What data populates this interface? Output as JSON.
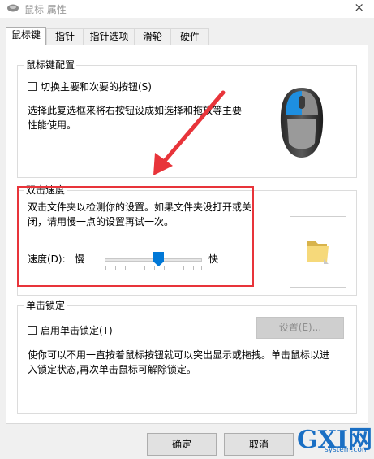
{
  "window": {
    "title": "鼠标 属性",
    "close_glyph": "×"
  },
  "tabs": [
    {
      "label": "鼠标键",
      "active": true
    },
    {
      "label": "指针",
      "active": false
    },
    {
      "label": "指针选项",
      "active": false
    },
    {
      "label": "滑轮",
      "active": false
    },
    {
      "label": "硬件",
      "active": false
    }
  ],
  "button_config": {
    "title": "鼠标键配置",
    "swap_label": "切换主要和次要的按钮(S)",
    "swap_checked": false,
    "desc_line1": "选择此复选框来将右按钮设成如选择和拖放等主要",
    "desc_line2": "性能使用。"
  },
  "double_click": {
    "title": "双击速度",
    "desc_line1": "双击文件夹以检测你的设置。如果文件夹没打开或关",
    "desc_line2": "闭，请用慢一点的设置再试一次。",
    "speed_label": "速度(D):",
    "slow_label": "慢",
    "fast_label": "快",
    "speed_fraction": 0.55
  },
  "click_lock": {
    "title": "单击锁定",
    "enable_label": "启用单击锁定(T)",
    "enable_checked": false,
    "settings_label": "设置(E)...",
    "desc_line1": "使你可以不用一直按着鼠标按钮就可以突出显示或拖拽。单击鼠标以进",
    "desc_line2": "入锁定状态,再次单击鼠标可解除锁定。"
  },
  "footer": {
    "ok_label": "确定",
    "cancel_label": "取消"
  },
  "watermark": {
    "logo_text": "GXI网",
    "site_text": "system.com"
  },
  "colors": {
    "accent_blue": "#0078d7",
    "highlight_red": "#e8343a"
  },
  "icons": {
    "title": "mouse-icon",
    "hardware": "mouse-hardware-image",
    "test": "folder-icon",
    "annotation": "red-arrow-icon"
  }
}
